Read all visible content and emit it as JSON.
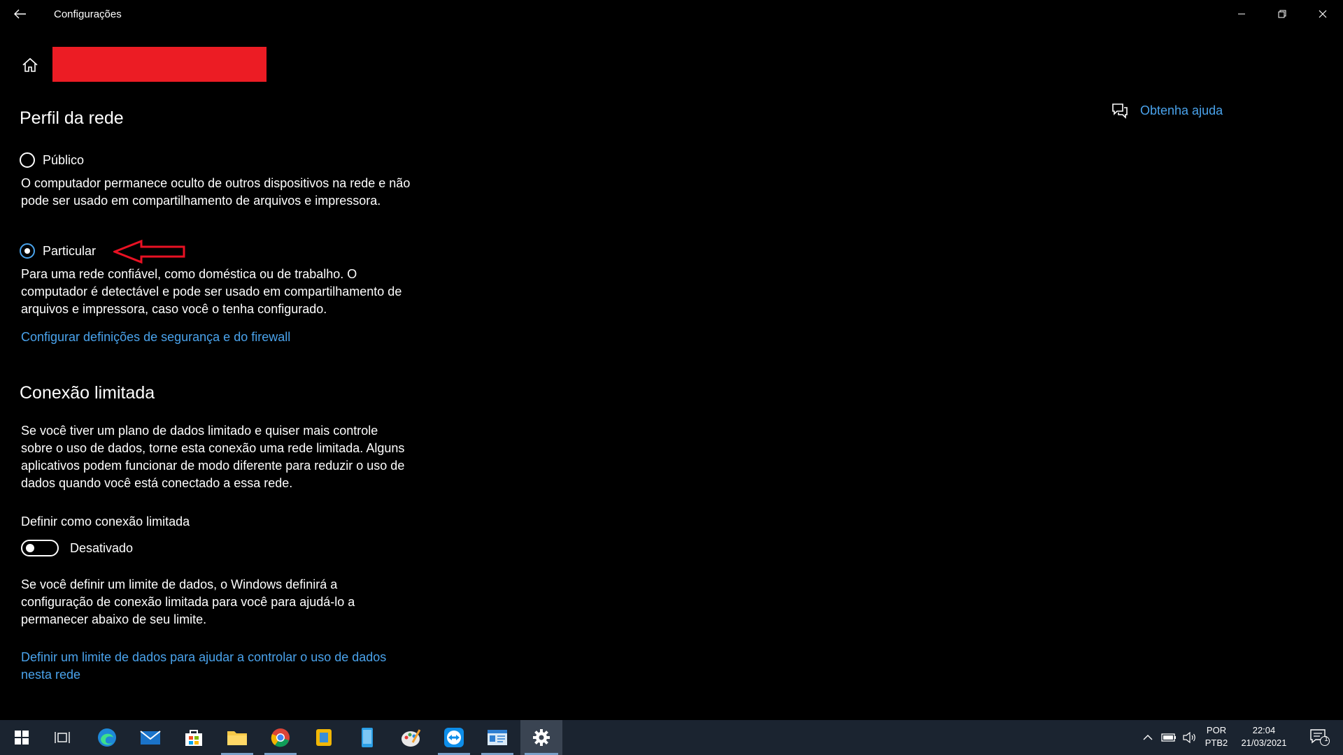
{
  "window": {
    "title": "Configurações"
  },
  "help": {
    "label": "Obtenha ajuda"
  },
  "network_profile": {
    "heading": "Perfil da rede",
    "options": [
      {
        "label": "Público",
        "selected": false,
        "description": "O computador permanece oculto de outros dispositivos na rede e não pode ser usado em compartilhamento de arquivos e impressora."
      },
      {
        "label": "Particular",
        "selected": true,
        "description": "Para uma rede confiável, como doméstica ou de trabalho. O computador é detectável e pode ser usado em compartilhamento de arquivos e impressora, caso você o tenha configurado."
      }
    ],
    "firewall_link": "Configurar definições de segurança e do firewall"
  },
  "metered": {
    "heading": "Conexão limitada",
    "description": "Se você tiver um plano de dados limitado e quiser mais controle sobre o uso de dados, torne esta conexão uma rede limitada. Alguns aplicativos podem funcionar de modo diferente para reduzir o uso de dados quando você está conectado a essa rede.",
    "toggle_title": "Definir como conexão limitada",
    "toggle_state": "Desativado",
    "note": "Se você definir um limite de dados, o Windows definirá a configuração de conexão limitada para você para ajudá-lo a permanecer abaixo de seu limite.",
    "data_limit_link": "Definir um limite de dados para ajudar a controlar o uso de dados nesta rede"
  },
  "taskbar": {
    "language": "POR",
    "keyboard": "PTB2",
    "time": "22:04",
    "date": "21/03/2021",
    "notification_count": "1",
    "apps": [
      "start-icon",
      "task-view-icon",
      "edge-icon",
      "mail-icon",
      "store-icon",
      "file-explorer-icon",
      "chrome-icon",
      "sticky-app-icon",
      "phone-app-icon",
      "paint-app-icon",
      "teamviewer-icon",
      "contacts-app-icon",
      "settings-icon"
    ]
  },
  "colors": {
    "accent": "#4aa3ec",
    "redaction": "#ec1c24",
    "taskbar": "#1b2430",
    "annotation_arrow": "#e81123"
  }
}
